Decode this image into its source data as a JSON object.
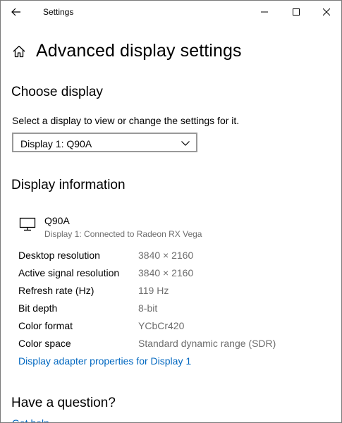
{
  "window": {
    "app_title": "Settings"
  },
  "header": {
    "title": "Advanced display settings"
  },
  "choose_display": {
    "heading": "Choose display",
    "description": "Select a display to view or change the settings for it.",
    "selected": "Display 1: Q90A"
  },
  "display_info": {
    "heading": "Display information",
    "monitor_name": "Q90A",
    "monitor_subtitle": "Display 1: Connected to Radeon RX Vega",
    "rows": [
      {
        "label": "Desktop resolution",
        "value": "3840 × 2160"
      },
      {
        "label": "Active signal resolution",
        "value": "3840 × 2160"
      },
      {
        "label": "Refresh rate (Hz)",
        "value": "119 Hz"
      },
      {
        "label": "Bit depth",
        "value": "8-bit"
      },
      {
        "label": "Color format",
        "value": "YCbCr420"
      },
      {
        "label": "Color space",
        "value": "Standard dynamic range (SDR)"
      }
    ],
    "adapter_link": "Display adapter properties for Display 1"
  },
  "question": {
    "heading": "Have a question?",
    "help_link": "Get help"
  },
  "icons": {
    "back": "back-arrow-icon",
    "home": "home-icon",
    "minimize": "minimize-icon",
    "maximize": "maximize-icon",
    "close": "close-icon",
    "monitor": "monitor-icon",
    "chevron": "chevron-down-icon"
  },
  "colors": {
    "link": "#0067c0",
    "secondary_text": "#6e6e6e",
    "border": "#999999"
  }
}
